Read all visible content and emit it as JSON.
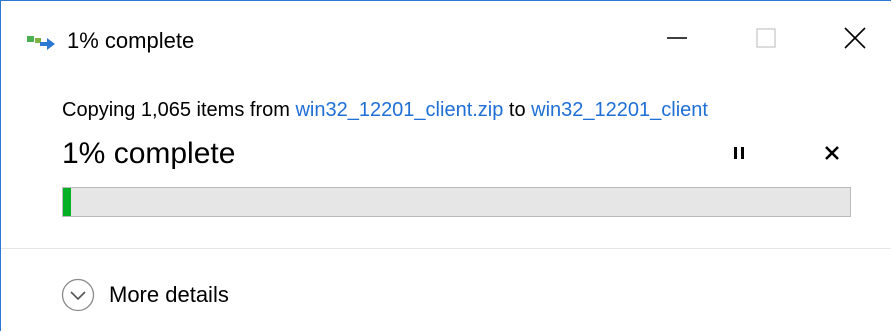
{
  "window": {
    "title": "1% complete",
    "controls": {
      "minimize_icon": "minimize-icon",
      "maximize_icon": "maximize-icon",
      "close_icon": "close-icon"
    }
  },
  "copy_status": {
    "prefix": "Copying 1,065 items from ",
    "source": "win32_12201_client.zip",
    "connector": " to ",
    "destination": "win32_12201_client",
    "heading": "1% complete",
    "progress_percent": 1,
    "pause_icon": "pause-icon",
    "cancel_icon": "cancel-icon"
  },
  "details": {
    "label": "More details",
    "icon": "chevron-down-circle-icon"
  },
  "colors": {
    "accent_border": "#2b79d3",
    "link": "#1e6fd6",
    "progress_fill": "#06b025",
    "progress_track": "#e6e6e6"
  }
}
